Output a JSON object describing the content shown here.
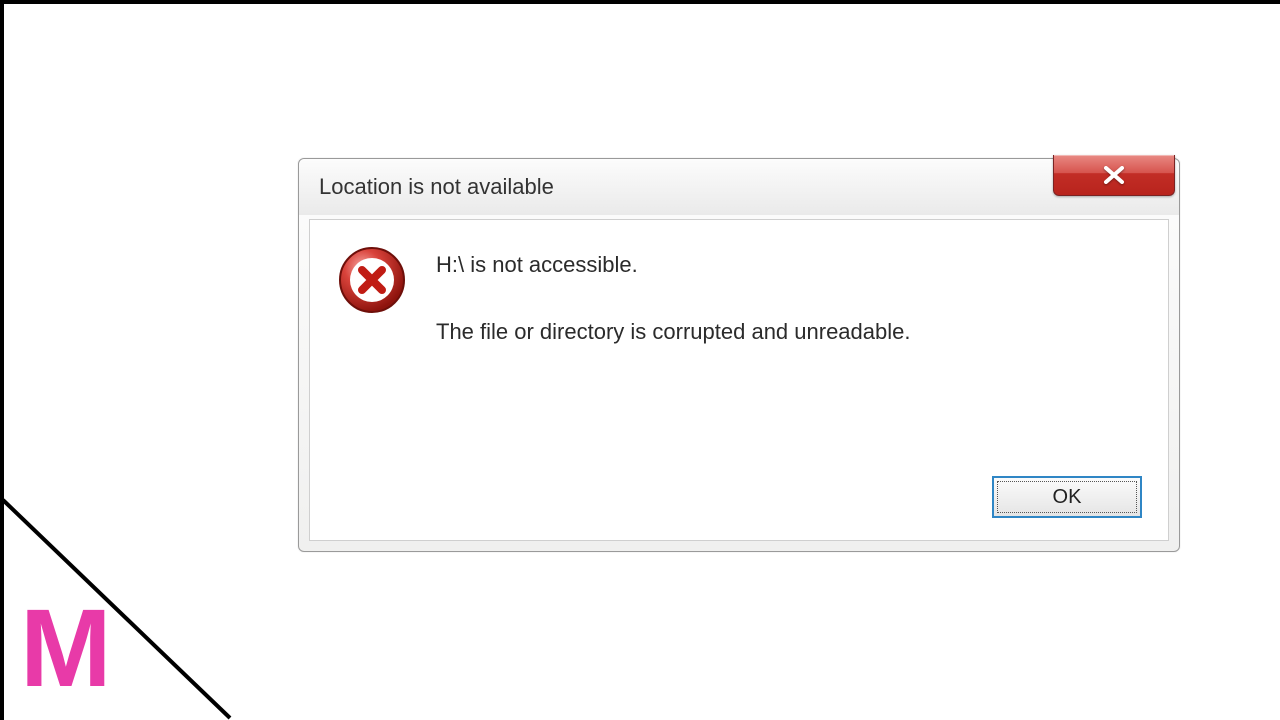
{
  "dialog": {
    "title": "Location is not available",
    "close_label": "x",
    "message_line1": "H:\\ is not accessible.",
    "message_line2": "The file or directory is corrupted and unreadable.",
    "ok_label": "OK"
  },
  "branding": {
    "logo_text": "M"
  },
  "colors": {
    "accent_pink": "#e83aa8",
    "close_red": "#c22d26",
    "focus_blue": "#2f86c5"
  }
}
